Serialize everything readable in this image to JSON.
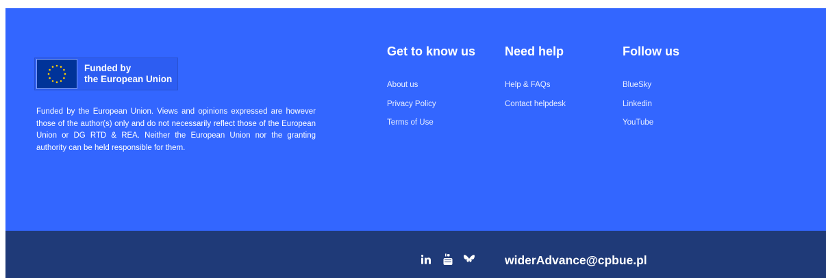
{
  "brand": {
    "eu_logo_text_line1": "Funded by",
    "eu_logo_text_line2": "the European Union",
    "disclaimer": "Funded by the European Union. Views and opinions expressed are however those of the author(s) only and do not necessarily reflect those of the European Union or DG RTD & REA. Neither the European Union nor the granting authority can be held responsible for them."
  },
  "columns": [
    {
      "title": "Get to know us",
      "links": [
        "About us",
        "Privacy Policy",
        "Terms of Use"
      ]
    },
    {
      "title": "Need help",
      "links": [
        "Help & FAQs",
        "Contact helpdesk"
      ]
    },
    {
      "title": "Follow us",
      "links": [
        "BlueSky",
        "Linkedin",
        "YouTube"
      ]
    }
  ],
  "bottom": {
    "social_icons": [
      "linkedin-icon",
      "youtube-icon",
      "bluesky-icon"
    ],
    "email": "widerAdvance@cpbue.pl"
  },
  "colors": {
    "footer_top": "#3366ff",
    "footer_bottom": "#1f3a78",
    "eu_flag": "#003399",
    "eu_star": "#ffcc00"
  }
}
